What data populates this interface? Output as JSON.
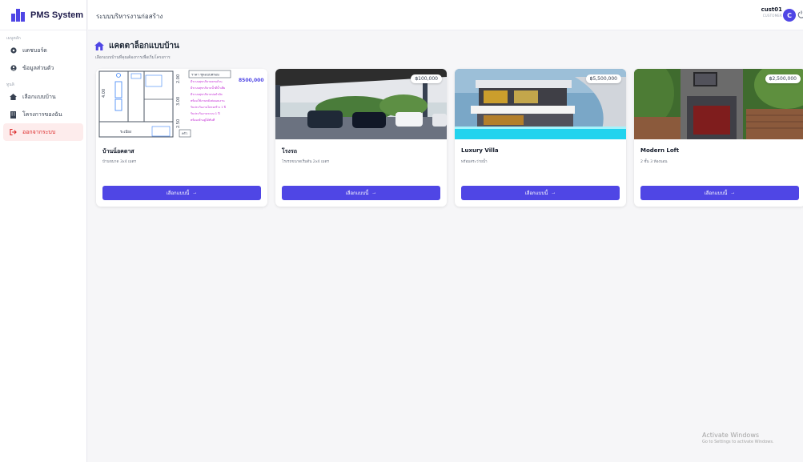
{
  "app": {
    "title": "PMS System"
  },
  "sidebar": {
    "section_main": "เมนูหลัก",
    "section_project": "ทูนลิ",
    "items": [
      {
        "label": "แดชบอร์ด",
        "icon": "dashboard-icon"
      },
      {
        "label": "ข้อมูลส่วนตัว",
        "icon": "user-icon"
      },
      {
        "label": "เลือกแบบบ้าน",
        "icon": "home-icon"
      },
      {
        "label": "โครงการของฉัน",
        "icon": "building-icon"
      },
      {
        "label": "ออกจากระบบ",
        "icon": "logout-icon"
      }
    ]
  },
  "topbar": {
    "title": "ระบบบริหารงานก่อสร้าง",
    "user_name": "cust01",
    "user_role": "CUSTOMER",
    "avatar_letter": "C"
  },
  "page": {
    "title": "แคตตาล็อกแบบบ้าน",
    "subtitle": "เลือกแบบบ้านที่คุณต้องการเพื่อเริ่มโครงการ"
  },
  "cards": [
    {
      "name": "บ้านน็อคดาส",
      "desc": "บ้านขนาด 3x4 เมตร",
      "price": "",
      "button": "เลือกแบบนี้"
    },
    {
      "name": "โรงรถ",
      "desc": "โรงรถขนาดเริ่มต้น 2x4 เมตร",
      "price": "฿100,000",
      "button": "เลือกแบบนี้"
    },
    {
      "name": "Luxury Villa",
      "desc": "พร้อมสระว่ายน้ำ",
      "price": "฿5,500,000",
      "button": "เลือกแบบนี้"
    },
    {
      "name": "Modern Loft",
      "desc": "2 ชั้น 3 ห้องนอน",
      "price": "฿2,500,000",
      "button": "เลือกแบบนี้"
    }
  ],
  "plan_sheet": {
    "header": "ราคา ชุดแบบพรอม",
    "price": "8500,000",
    "room_label": "ระเบียง",
    "door_label": "ครัว",
    "dim_labels": [
      "4.00",
      "2.00",
      "3.00",
      "2.50"
    ],
    "notes": [
      "มีระบบสุขาภิบาลครบถ้วน",
      "มีระบบสุขาภิบาลน้ำดีน้ำเสีย",
      "มีระบบสุขาภิบาลบ่อบำบัด",
      "พร้อมใช้งานหลังส่งมอบงาน",
      "รับประกันงานโครงสร้าง 1 ปี",
      "รับประกันงานระบบ 1 ปี",
      "พร้อมเข้าอยู่ได้ทันที"
    ]
  },
  "watermark": {
    "line1": "Activate Windows",
    "line2": "Go to Settings to activate Windows."
  },
  "colors": {
    "accent": "#4f46e5",
    "logout": "#dc2626"
  }
}
